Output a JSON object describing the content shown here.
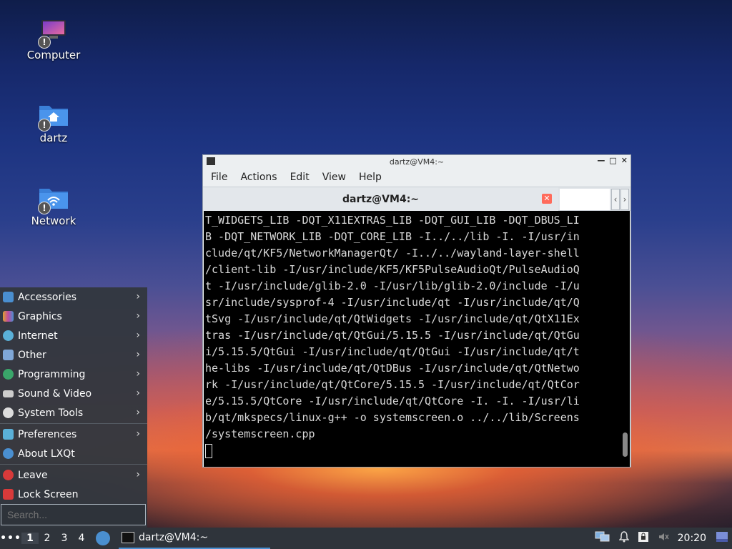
{
  "desktop": {
    "icons": [
      {
        "label": "Computer"
      },
      {
        "label": "dartz"
      },
      {
        "label": "Network"
      }
    ],
    "badge": "!"
  },
  "terminal": {
    "title": "dartz@VM4:~",
    "menu": [
      "File",
      "Actions",
      "Edit",
      "View",
      "Help"
    ],
    "tab_title": "dartz@VM4:~",
    "lines": [
      "T_WIDGETS_LIB -DQT_X11EXTRAS_LIB -DQT_GUI_LIB -DQT_DBUS_LI",
      "B -DQT_NETWORK_LIB -DQT_CORE_LIB -I../../lib -I. -I/usr/in",
      "clude/qt/KF5/NetworkManagerQt/ -I../../wayland-layer-shell",
      "/client-lib -I/usr/include/KF5/KF5PulseAudioQt/PulseAudioQ",
      "t -I/usr/include/glib-2.0 -I/usr/lib/glib-2.0/include -I/u",
      "sr/include/sysprof-4 -I/usr/include/qt -I/usr/include/qt/Q",
      "tSvg -I/usr/include/qt/QtWidgets -I/usr/include/qt/QtX11Ex",
      "tras -I/usr/include/qt/QtGui/5.15.5 -I/usr/include/qt/QtGu",
      "i/5.15.5/QtGui -I/usr/include/qt/QtGui -I/usr/include/qt/t",
      "he-libs -I/usr/include/qt/QtDBus -I/usr/include/qt/QtNetwo",
      "rk -I/usr/include/qt/QtCore/5.15.5 -I/usr/include/qt/QtCor",
      "e/5.15.5/QtCore -I/usr/include/qt/QtCore -I. -I. -I/usr/li",
      "b/qt/mkspecs/linux-g++ -o systemscreen.o ../../lib/Screens",
      "/systemscreen.cpp"
    ]
  },
  "start_menu": {
    "items": [
      {
        "label": "Accessories",
        "icon": "accessories-icon",
        "color": "#4a8fd0",
        "submenu": true
      },
      {
        "label": "Graphics",
        "icon": "graphics-icon",
        "color": "#e0a030",
        "submenu": true
      },
      {
        "label": "Internet",
        "icon": "internet-icon",
        "color": "#5ab0d8",
        "submenu": true
      },
      {
        "label": "Other",
        "icon": "other-icon",
        "color": "#7fa7d8",
        "submenu": true
      },
      {
        "label": "Programming",
        "icon": "programming-icon",
        "color": "#3aa66a",
        "submenu": true
      },
      {
        "label": "Sound & Video",
        "icon": "sound-video-icon",
        "color": "#cccccc",
        "submenu": true
      },
      {
        "label": "System Tools",
        "icon": "system-tools-icon",
        "color": "#dddddd",
        "submenu": true
      },
      {
        "label": "Preferences",
        "icon": "preferences-icon",
        "color": "#5ab0d8",
        "submenu": true
      },
      {
        "label": "About LXQt",
        "icon": "lxqt-icon",
        "color": "#4a8fd0",
        "submenu": false
      },
      {
        "label": "Leave",
        "icon": "leave-icon",
        "color": "#d83a3a",
        "submenu": true
      },
      {
        "label": "Lock Screen",
        "icon": "lock-icon",
        "color": "#d83a3a",
        "submenu": false
      }
    ],
    "search_placeholder": "Search..."
  },
  "taskbar": {
    "menu_glyph": "•••",
    "desktops": [
      "1",
      "2",
      "3",
      "4"
    ],
    "active_desktop": "1",
    "task_label": "dartz@VM4:~",
    "clock": "20:20"
  }
}
